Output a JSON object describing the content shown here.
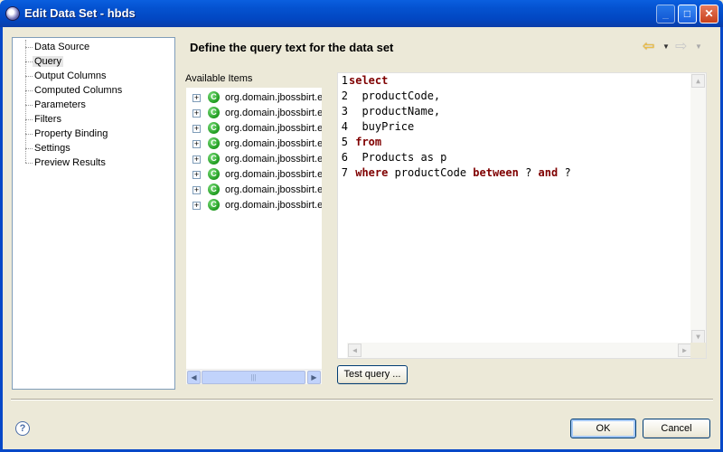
{
  "window": {
    "title": "Edit Data Set - hbds"
  },
  "nav": {
    "items": [
      {
        "label": "Data Source",
        "selected": false
      },
      {
        "label": "Query",
        "selected": true
      },
      {
        "label": "Output Columns",
        "selected": false
      },
      {
        "label": "Computed Columns",
        "selected": false
      },
      {
        "label": "Parameters",
        "selected": false
      },
      {
        "label": "Filters",
        "selected": false
      },
      {
        "label": "Property Binding",
        "selected": false
      },
      {
        "label": "Settings",
        "selected": false
      },
      {
        "label": "Preview Results",
        "selected": false
      }
    ]
  },
  "header": {
    "title": "Define the query text for the data set"
  },
  "available": {
    "label": "Available Items",
    "items": [
      "org.domain.jbossbirt.e",
      "org.domain.jbossbirt.e",
      "org.domain.jbossbirt.e",
      "org.domain.jbossbirt.e",
      "org.domain.jbossbirt.e",
      "org.domain.jbossbirt.e",
      "org.domain.jbossbirt.e",
      "org.domain.jbossbirt.e"
    ]
  },
  "editor": {
    "lines": [
      {
        "num": "1",
        "parts": [
          {
            "t": "select",
            "kw": true
          }
        ]
      },
      {
        "num": "2",
        "parts": [
          {
            "t": "  productCode,",
            "kw": false
          }
        ]
      },
      {
        "num": "3",
        "parts": [
          {
            "t": "  productName,",
            "kw": false
          }
        ]
      },
      {
        "num": "4",
        "parts": [
          {
            "t": "  buyPrice",
            "kw": false
          }
        ]
      },
      {
        "num": "5",
        "parts": [
          {
            "t": " ",
            "kw": false
          },
          {
            "t": "from",
            "kw": true
          }
        ]
      },
      {
        "num": "6",
        "parts": [
          {
            "t": "  Products as p",
            "kw": false
          }
        ]
      },
      {
        "num": "7",
        "parts": [
          {
            "t": " ",
            "kw": false
          },
          {
            "t": "where",
            "kw": true
          },
          {
            "t": " productCode ",
            "kw": false
          },
          {
            "t": "between",
            "kw": true
          },
          {
            "t": " ? ",
            "kw": false
          },
          {
            "t": "and",
            "kw": true
          },
          {
            "t": " ?",
            "kw": false
          }
        ]
      }
    ]
  },
  "buttons": {
    "test_query": "Test query ...",
    "ok": "OK",
    "cancel": "Cancel"
  },
  "icons": {
    "help": "?",
    "class_badge": "C",
    "expand": "+"
  },
  "colors": {
    "keyword": "#7f0000",
    "title_bar": "#0452d0"
  }
}
